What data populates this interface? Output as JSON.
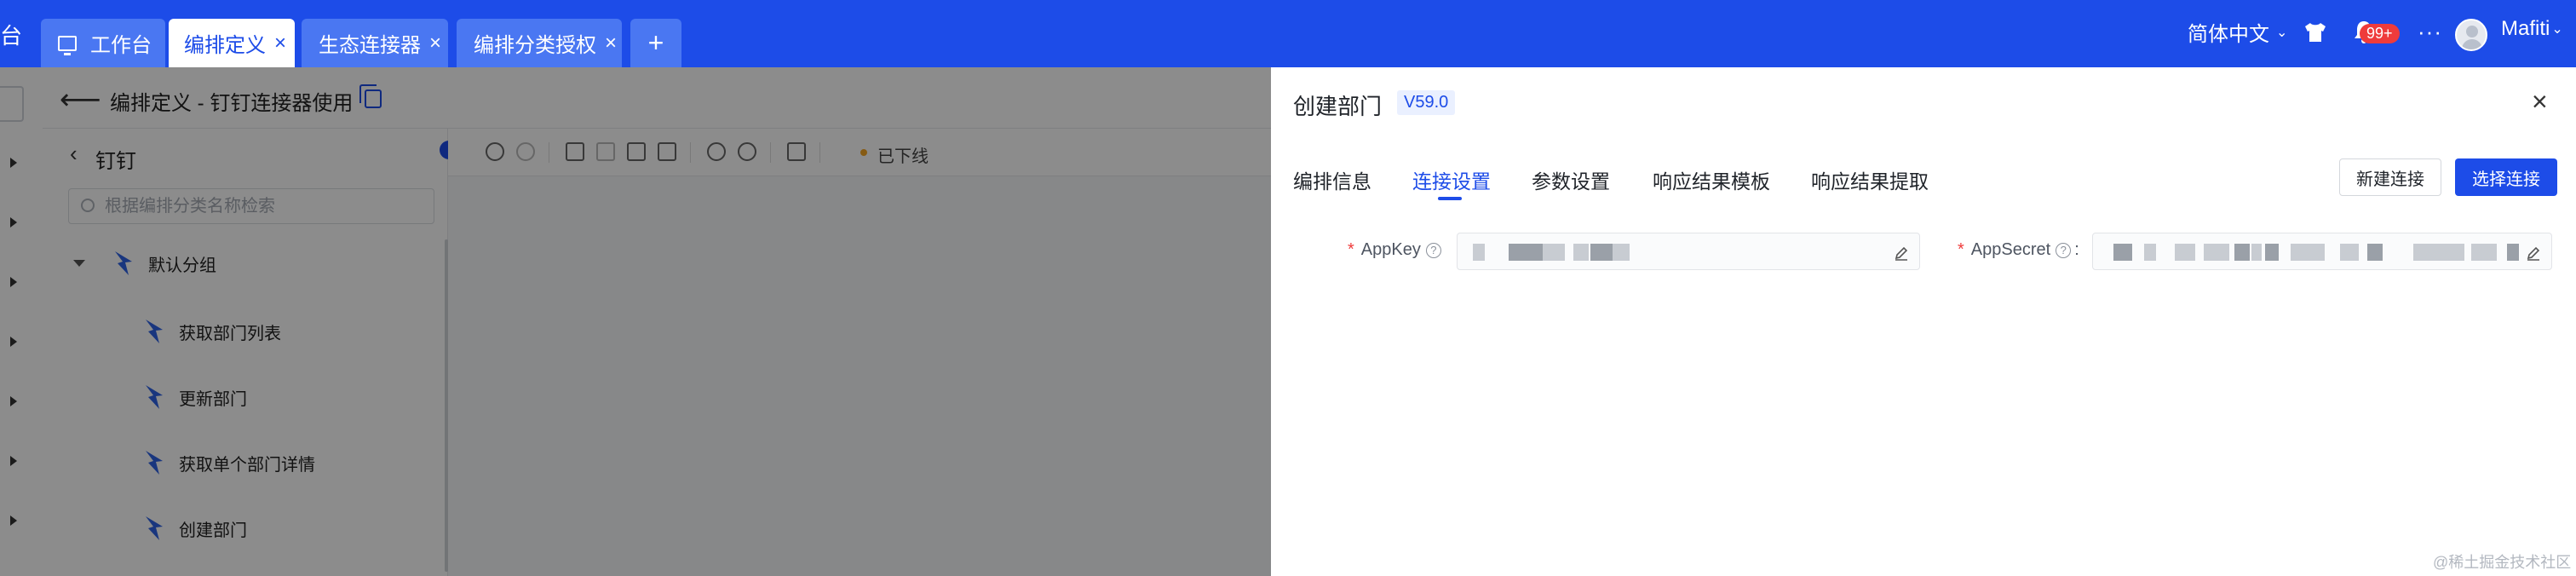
{
  "topbar": {
    "brand_text": "台",
    "tabs": [
      {
        "label": "工作台",
        "icon": "workbench-icon",
        "closable": false,
        "active": false
      },
      {
        "label": "编排定义",
        "closable": true,
        "active": true
      },
      {
        "label": "生态连接器",
        "closable": true,
        "active": false
      },
      {
        "label": "编排分类授权",
        "closable": true,
        "active": false
      }
    ],
    "add_tab_label": "+",
    "close_glyph": "×",
    "language": "简体中文",
    "notification_badge": "99+",
    "more_label": "···",
    "username": "Mafiti",
    "accent_color": "#1d4ce8"
  },
  "workspace": {
    "back_arrow": "⟵",
    "page_title": "编排定义 - 钉钉连接器使用",
    "panel_title": "钉钉",
    "panel_back": "‹",
    "search_placeholder": "根据编排分类名称检索",
    "group_name": "默认分组",
    "tree_items": [
      "获取部门列表",
      "更新部门",
      "获取单个部门详情",
      "创建部门"
    ],
    "status_text": "已下线",
    "status_color": "#f5a623"
  },
  "drawer": {
    "title": "创建部门",
    "version": "V59.0",
    "close_glyph": "×",
    "tabs": [
      {
        "label": "编排信息",
        "active": false
      },
      {
        "label": "连接设置",
        "active": true
      },
      {
        "label": "参数设置",
        "active": false
      },
      {
        "label": "响应结果模板",
        "active": false
      },
      {
        "label": "响应结果提取",
        "active": false
      }
    ],
    "new_connection_label": "新建连接",
    "select_connection_label": "选择连接",
    "required_mark": "*",
    "help_glyph": "?",
    "fields": [
      {
        "label": "AppKey",
        "suffix": "",
        "value": "••••••••••••"
      },
      {
        "label": "AppSecret",
        "suffix": " :",
        "value": "••••••••••••••••••••••••"
      }
    ]
  },
  "watermark": "@稀土掘金技术社区"
}
